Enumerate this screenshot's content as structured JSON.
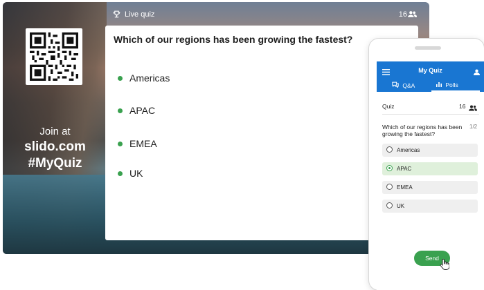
{
  "slide": {
    "live_label": "Live quiz",
    "participants": "16",
    "join": {
      "line1": "Join at",
      "line2": "slido.com",
      "line3": "#MyQuiz"
    },
    "question": "Which of our regions has been growing the fastest?",
    "options": [
      "Americas",
      "APAC",
      "EMEA",
      "UK"
    ],
    "accent": "#3aa14f"
  },
  "phone": {
    "app_title": "My Quiz",
    "tabs": {
      "qa": "Q&A",
      "polls": "Polls"
    },
    "quiz_label": "Quiz",
    "participants": "16",
    "question": "Which of our regions has been growing the fastest?",
    "pager": "1/2",
    "options": [
      "Americas",
      "APAC",
      "EMEA",
      "UK"
    ],
    "selected_option": "APAC",
    "send_label": "Send",
    "brand_color": "#1976d2"
  },
  "icons": [
    "trophy-icon",
    "people-icon",
    "menu-icon",
    "user-icon",
    "chat-icon",
    "bar-chart-icon",
    "radio-icon",
    "hand-cursor-icon",
    "qr-code"
  ]
}
